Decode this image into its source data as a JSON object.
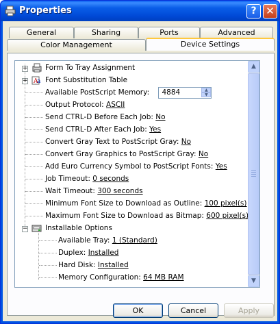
{
  "window": {
    "title": "Properties",
    "help_glyph": "?",
    "close_glyph": "✕",
    "colors": {
      "titlebar": "#0054e3",
      "accent_tab": "#ffc83c"
    }
  },
  "tabs_top": [
    {
      "label": "General"
    },
    {
      "label": "Sharing"
    },
    {
      "label": "Ports"
    },
    {
      "label": "Advanced"
    }
  ],
  "tabs_bottom": [
    {
      "label": "Color Management"
    },
    {
      "label": "Device Settings",
      "active": true
    }
  ],
  "tree": {
    "form_to_tray": "Form To Tray Assignment",
    "font_substitution": "Font Substitution Table",
    "postscript_memory": {
      "label": "Available PostScript Memory:",
      "value": "4884"
    },
    "settings": [
      {
        "label": "Output Protocol:",
        "value": "ASCII"
      },
      {
        "label": "Send CTRL-D Before Each Job:",
        "value": "No"
      },
      {
        "label": "Send CTRL-D After Each Job:",
        "value": "Yes"
      },
      {
        "label": "Convert Gray Text to PostScript Gray:",
        "value": "No"
      },
      {
        "label": "Convert Gray Graphics to PostScript Gray:",
        "value": "No"
      },
      {
        "label": "Add Euro Currency Symbol to PostScript Fonts:",
        "value": "Yes"
      },
      {
        "label": "Job Timeout:",
        "value": "0 seconds"
      },
      {
        "label": "Wait Timeout:",
        "value": "300 seconds"
      },
      {
        "label": "Minimum Font Size to Download as Outline:",
        "value": "100 pixel(s)"
      },
      {
        "label": "Maximum Font Size to Download as Bitmap:",
        "value": "600 pixel(s)"
      }
    ],
    "installable_options": "Installable Options",
    "options": [
      {
        "label": "Available Tray:",
        "value": "1 (Standard)"
      },
      {
        "label": "Duplex:",
        "value": "Installed"
      },
      {
        "label": "Hard Disk:",
        "value": "Installed"
      },
      {
        "label": "Memory Configuration:",
        "value": "64 MB RAM"
      }
    ],
    "expander_plus": "+",
    "expander_minus": "−"
  },
  "buttons": {
    "ok": "OK",
    "cancel": "Cancel",
    "apply": "Apply"
  }
}
